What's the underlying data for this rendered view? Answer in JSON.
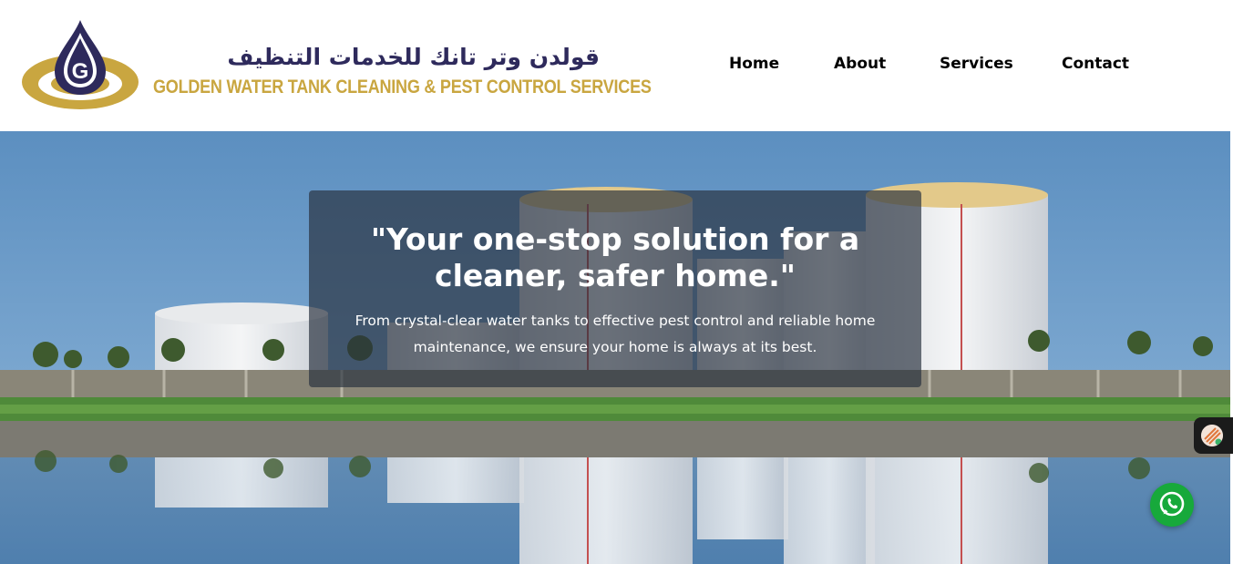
{
  "brand": {
    "arabic_name": "قولدن وتر تانك للخدمات التنظيف",
    "english_name": "GOLDEN WATER TANK CLEANING & PEST CONTROL SERVICES",
    "logo_letter": "G",
    "logo_icon": "water-drop-logo-icon",
    "primary_color": "#2e2a5c",
    "gold_color": "#c9a640"
  },
  "nav": {
    "items": [
      {
        "label": "Home"
      },
      {
        "label": "About"
      },
      {
        "label": "Services"
      },
      {
        "label": "Contact"
      }
    ]
  },
  "hero": {
    "title": "\"Your one-stop solution for a cleaner, safer home.\"",
    "subtitle": "From crystal-clear water tanks to effective pest control and reliable home maintenance, we ensure your home is always at its best."
  },
  "widgets": {
    "side_widget_icon": "chat-avatar-icon",
    "whatsapp_icon": "whatsapp-icon",
    "whatsapp_color": "#17a93b"
  }
}
